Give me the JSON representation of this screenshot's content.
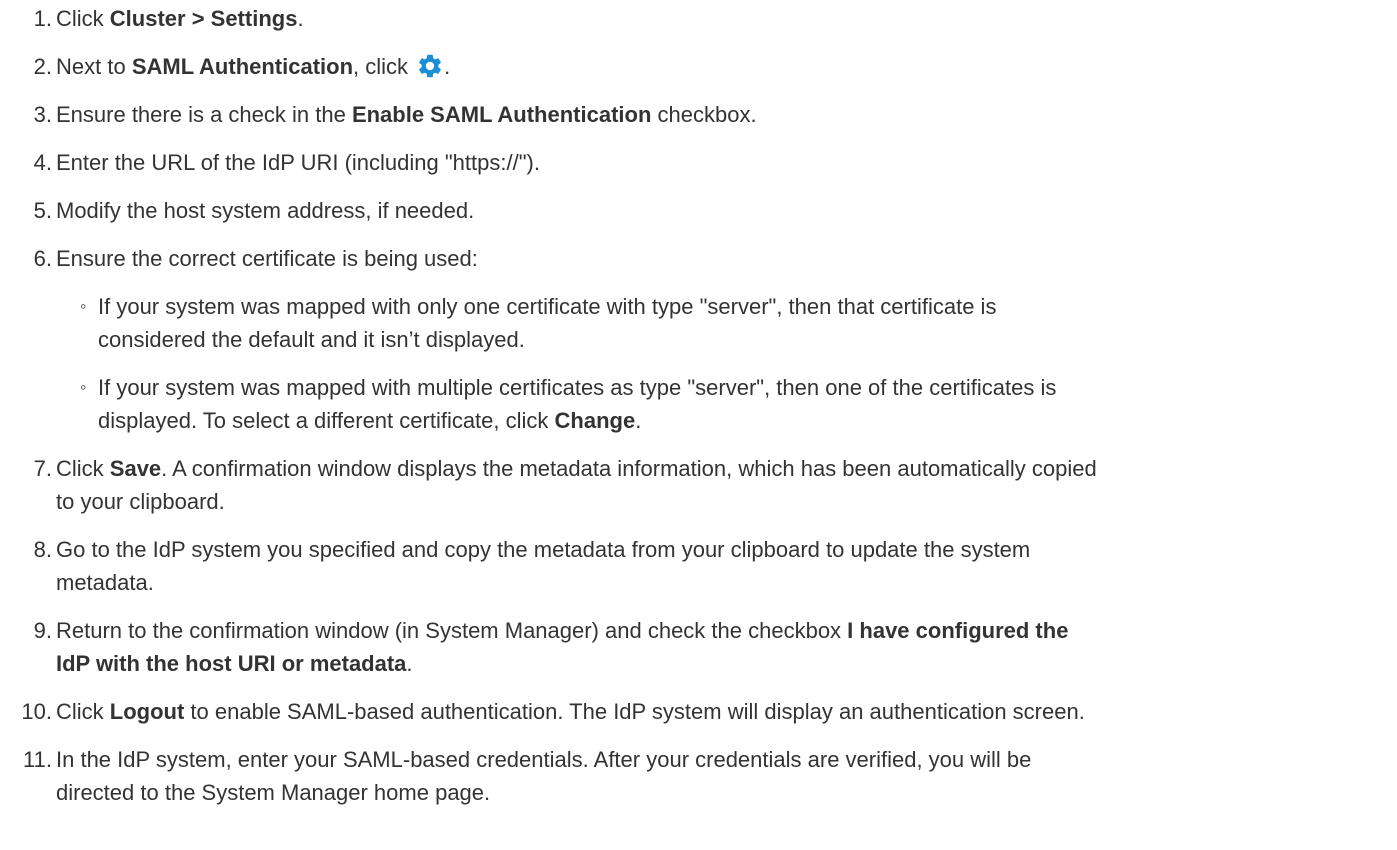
{
  "steps": [
    {
      "num": "1.",
      "parts": {
        "a": "Click ",
        "b": "Cluster > Settings",
        "c": "."
      }
    },
    {
      "num": "2.",
      "parts": {
        "a": "Next to ",
        "b": "SAML Authentication",
        "c": ", click ",
        "d": "."
      },
      "icon": "gear-icon"
    },
    {
      "num": "3.",
      "parts": {
        "a": "Ensure there is a check in the ",
        "b": "Enable SAML Authentication",
        "c": " checkbox."
      }
    },
    {
      "num": "4.",
      "parts": {
        "a": "Enter the URL of the IdP URI (including \"https://\")."
      }
    },
    {
      "num": "5.",
      "parts": {
        "a": "Modify the host system address, if needed."
      }
    },
    {
      "num": "6.",
      "parts": {
        "a": "Ensure the correct certificate is being used:"
      }
    },
    {
      "num": "7.",
      "parts": {
        "a": "Click ",
        "b": "Save",
        "c": ". A confirmation window displays the metadata information, which has been automatically copied",
        "d": "to your clipboard."
      }
    },
    {
      "num": "8.",
      "parts": {
        "a": "Go to the IdP system you specified and copy the metadata from your clipboard to update the system",
        "b": "metadata."
      }
    },
    {
      "num": "9.",
      "parts": {
        "a": "Return to the confirmation window (in System Manager) and check the checkbox ",
        "b": "I have configured the",
        "c": "IdP with the host URI or metadata",
        "d": "."
      }
    },
    {
      "num": "10.",
      "parts": {
        "a": "Click ",
        "b": "Logout",
        "c": " to enable SAML-based authentication. The IdP system will display an authentication screen."
      }
    },
    {
      "num": "11.",
      "parts": {
        "a": "In the IdP system, enter your SAML-based credentials. After your credentials are verified, you will be",
        "b": "directed to the System Manager home page."
      }
    }
  ],
  "substeps": [
    {
      "bullet": "◦",
      "line1": "If your system was mapped with only one certificate with type \"server\", then that certificate is",
      "line2": "considered the default and it isn’t displayed."
    },
    {
      "bullet": "◦",
      "line1": "If your system was mapped with multiple certificates as type \"server\", then one of the certificates is",
      "line2a": "displayed. To select a different certificate, click ",
      "line2b": "Change",
      "line2c": "."
    }
  ],
  "colors": {
    "text": "#333333",
    "gear": "#1a8fd8"
  }
}
